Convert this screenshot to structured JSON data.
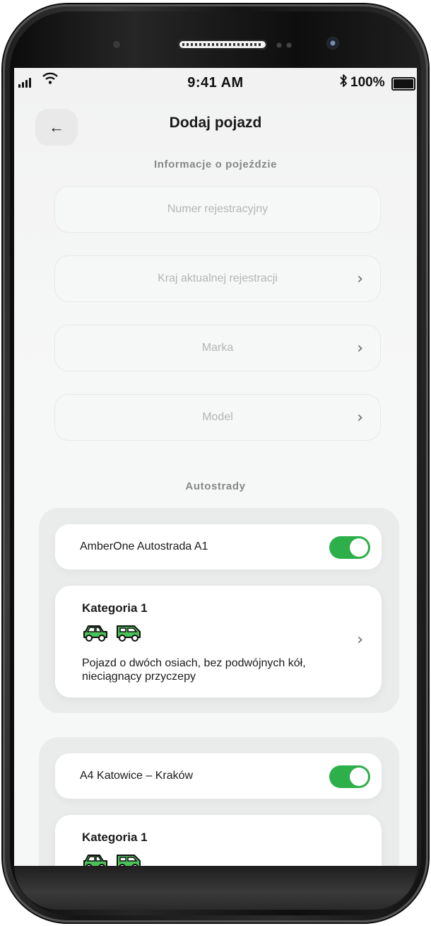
{
  "status_bar": {
    "time": "9:41 AM",
    "battery_pct": "100%"
  },
  "header": {
    "title": "Dodaj pojazd"
  },
  "vehicle_info": {
    "section_label": "Informacje o pojeździe",
    "fields": [
      {
        "placeholder": "Numer rejestracyjny",
        "has_chevron": false
      },
      {
        "placeholder": "Kraj aktualnej rejestracji",
        "has_chevron": true
      },
      {
        "placeholder": "Marka",
        "has_chevron": true
      },
      {
        "placeholder": "Model",
        "has_chevron": true
      }
    ]
  },
  "highways": {
    "section_label": "Autostrady",
    "groups": [
      {
        "name": "AmberOne Autostrada A1",
        "enabled": true,
        "category": {
          "title": "Kategoria 1",
          "description": "Pojazd o dwóch osiach, bez podwójnych kół, nieciągnący przyczepy"
        }
      },
      {
        "name": "A4 Katowice – Kraków",
        "enabled": true,
        "category": {
          "title": "Kategoria 1",
          "description": ""
        }
      }
    ]
  },
  "colors": {
    "accent_green": "#2daf4a",
    "icon_green": "#4cc25a"
  }
}
